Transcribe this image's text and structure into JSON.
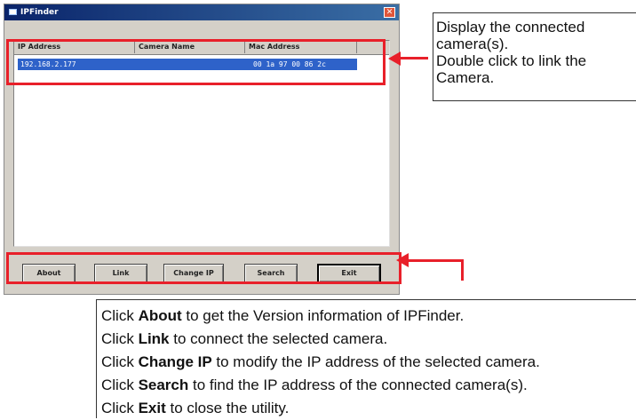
{
  "window": {
    "title": "IPFinder",
    "close_glyph": "✕"
  },
  "list": {
    "columns": [
      "IP Address",
      "Camera Name",
      "Mac Address"
    ],
    "rows": [
      {
        "ip": "192.168.2.177",
        "name": "",
        "mac": "00 1a 97 00 86 2c"
      }
    ]
  },
  "buttons": {
    "about": "About",
    "link": "Link",
    "change_ip": "Change IP",
    "search": "Search",
    "exit": "Exit"
  },
  "callout_top": {
    "line1": "Display the connected",
    "line2": "camera(s).",
    "line3": "Double click to link the",
    "line4": "Camera."
  },
  "callout_bottom": {
    "lines": [
      {
        "pre": "Click ",
        "bold": "About",
        "post": " to get the Version information of IPFinder."
      },
      {
        "pre": "Click ",
        "bold": "Link",
        "post": " to connect the selected camera."
      },
      {
        "pre": "Click ",
        "bold": "Change IP",
        "post": " to modify the IP address of the selected camera."
      },
      {
        "pre": "Click ",
        "bold": "Search",
        "post": " to find the IP address of the connected camera(s)."
      },
      {
        "pre": "Click ",
        "bold": "Exit",
        "post": " to close the utility."
      }
    ]
  },
  "colors": {
    "highlight": "#e8202a",
    "selection": "#2e62c9",
    "titlebar": "#0a246a"
  }
}
